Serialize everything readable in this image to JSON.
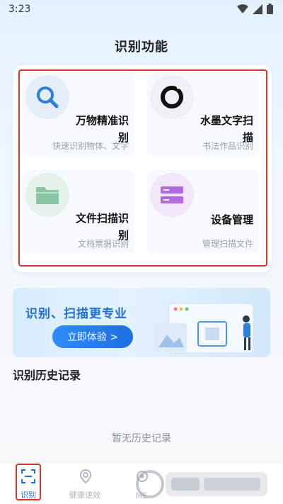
{
  "status_bar": {
    "time": "3:23"
  },
  "page_title": "识别功能",
  "features": [
    {
      "title": "万物精准识别",
      "subtitle": "快速识别物体、文字",
      "icon": "search-icon"
    },
    {
      "title": "水墨文字扫描",
      "subtitle": "书法作品识别",
      "icon": "ink-circle-icon"
    },
    {
      "title": "文件扫描识别",
      "subtitle": "文档票据识别",
      "icon": "folder-icon"
    },
    {
      "title": "设备管理",
      "subtitle": "管理扫描文件",
      "icon": "device-list-icon"
    }
  ],
  "banner": {
    "text": "识别、扫描更专业",
    "button": "立即体验 >"
  },
  "history": {
    "title": "识别历史记录",
    "empty": "暂无历史记录"
  },
  "bottom_nav": [
    {
      "label": "识别",
      "active": true
    },
    {
      "label": "健康速效",
      "active": false
    },
    {
      "label": "ME",
      "active": false
    }
  ],
  "colors": {
    "accent": "#1f6fe0",
    "highlight": "#d9342b",
    "folder": "#8ac6a5",
    "device": "#b06be0"
  }
}
